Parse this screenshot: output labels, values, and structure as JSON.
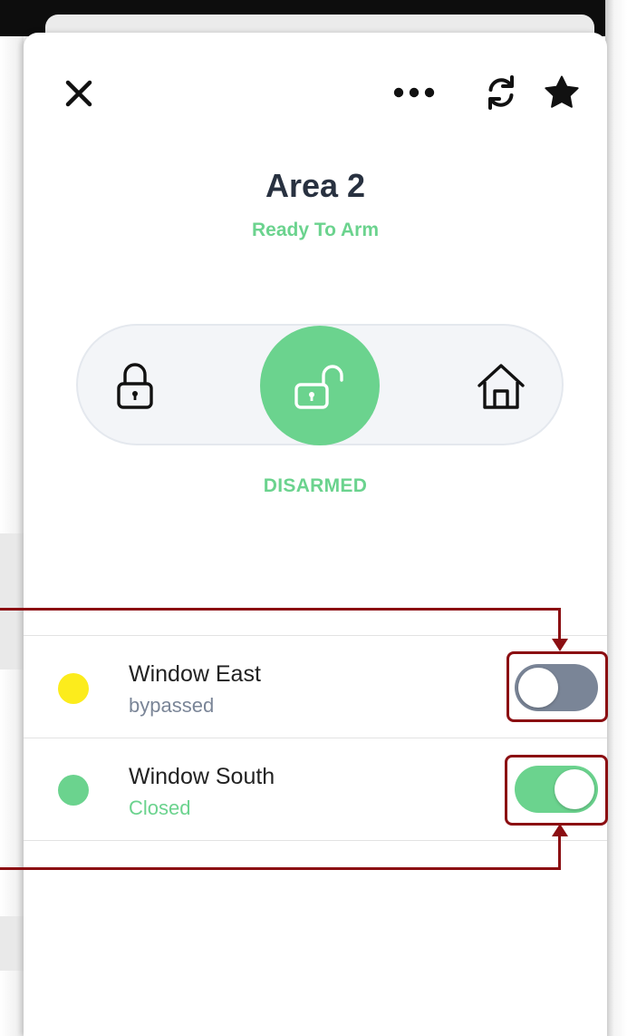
{
  "header": {
    "close_icon": "close-icon",
    "more_icon": "more-icon",
    "refresh_icon": "refresh-icon",
    "favorite_icon": "star-icon"
  },
  "area": {
    "title": "Area 2",
    "status": "Ready To Arm"
  },
  "arm_modes": {
    "options": [
      {
        "id": "away",
        "icon": "locked-padlock-icon"
      },
      {
        "id": "disarmed",
        "icon": "unlocked-padlock-icon",
        "selected": true
      },
      {
        "id": "stay",
        "icon": "home-icon"
      }
    ],
    "current_label": "DISARMED"
  },
  "zones": [
    {
      "name": "Window East",
      "status": "bypassed",
      "dot_color": "#fcec1c",
      "status_color": "#7a8597",
      "toggle_on": false
    },
    {
      "name": "Window South",
      "status": "Closed",
      "dot_color": "#6bd38e",
      "status_color": "#6bd38e",
      "toggle_on": true
    }
  ],
  "colors": {
    "accent_green": "#6bd38e",
    "title_text": "#283140",
    "toggle_off": "#7a8597",
    "annotation": "#8b0e12"
  }
}
